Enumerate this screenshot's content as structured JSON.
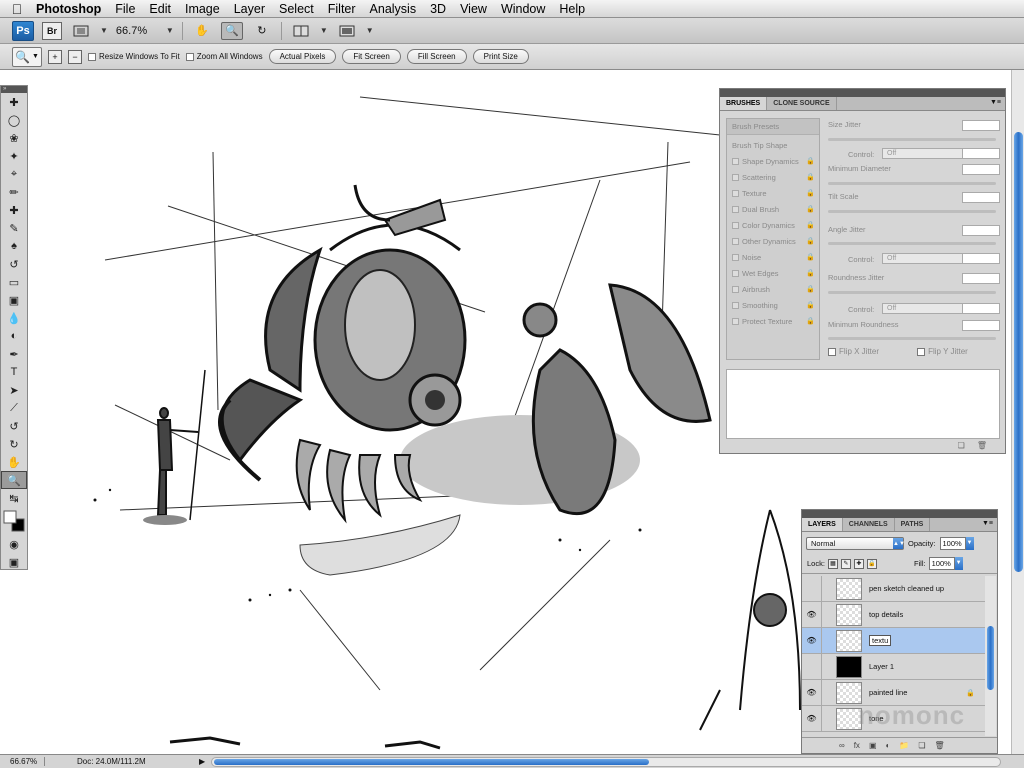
{
  "menubar": {
    "app": "Photoshop",
    "items": [
      "File",
      "Edit",
      "Image",
      "Layer",
      "Select",
      "Filter",
      "Analysis",
      "3D",
      "View",
      "Window",
      "Help"
    ]
  },
  "appbar": {
    "ps_logo": "Ps",
    "br_logo": "Br",
    "zoom": "66.7%"
  },
  "options": {
    "resize_windows": "Resize Windows To Fit",
    "zoom_all": "Zoom All Windows",
    "buttons": [
      "Actual Pixels",
      "Fit Screen",
      "Fill Screen",
      "Print Size"
    ]
  },
  "status": {
    "zoom": "66.67%",
    "doc": "Doc: 24.0M/111.2M"
  },
  "brushes_panel": {
    "tabs": [
      "BRUSHES",
      "CLONE SOURCE"
    ],
    "presets": "Brush Presets",
    "tip_shape": "Brush Tip Shape",
    "options": [
      "Shape Dynamics",
      "Scattering",
      "Texture",
      "Dual Brush",
      "Color Dynamics",
      "Other Dynamics",
      "Noise",
      "Wet Edges",
      "Airbrush",
      "Smoothing",
      "Protect Texture"
    ],
    "settings": {
      "size_jitter": "Size Jitter",
      "control": "Control:",
      "off": "Off",
      "min_diameter": "Minimum Diameter",
      "tilt_scale": "Tilt Scale",
      "angle_jitter": "Angle Jitter",
      "roundness_jitter": "Roundness Jitter",
      "min_roundness": "Minimum Roundness",
      "flip_x": "Flip X Jitter",
      "flip_y": "Flip Y Jitter"
    }
  },
  "layers_panel": {
    "tabs": [
      "LAYERS",
      "CHANNELS",
      "PATHS"
    ],
    "blend_mode": "Normal",
    "opacity_label": "Opacity:",
    "opacity": "100%",
    "lock_label": "Lock:",
    "fill_label": "Fill:",
    "fill": "100%",
    "layers": [
      {
        "name": "pen sketch cleaned up",
        "visible": false,
        "selected": false
      },
      {
        "name": "top details",
        "visible": true,
        "selected": false
      },
      {
        "name": "textu",
        "visible": true,
        "selected": true
      },
      {
        "name": "Layer 1",
        "visible": false,
        "selected": false
      },
      {
        "name": "painted line",
        "visible": true,
        "selected": false
      },
      {
        "name": "tone",
        "visible": true,
        "selected": false
      }
    ]
  },
  "watermark": "nomonc"
}
